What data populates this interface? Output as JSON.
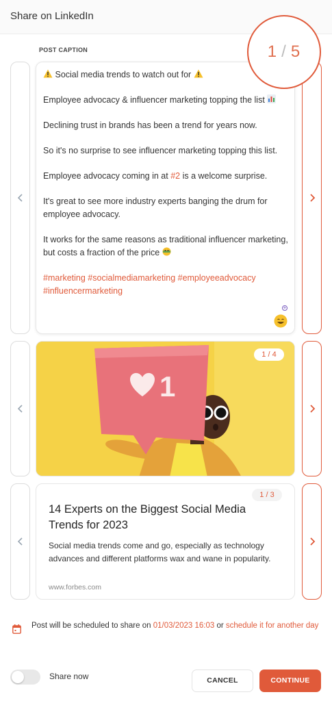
{
  "header": {
    "title": "Share on LinkedIn"
  },
  "caption_section": {
    "label": "POST CAPTION"
  },
  "post_counter": {
    "current": "1",
    "total": "5"
  },
  "caption": {
    "line1": "Social media trends to watch out for",
    "line2": "Employee advocacy & influencer marketing topping the list",
    "para2": "Declining trust in brands has been a trend for years now.",
    "para3": "So it's no surprise to see influencer marketing topping this list.",
    "para4_before": "Employee advocacy coming in at ",
    "para4_tag": "#2",
    "para4_after": " is a welcome surprise.",
    "para5": "It's great to see more industry experts banging the drum for employee advocacy.",
    "para6": "It works for the same reasons as traditional influencer marketing, but costs a fraction of the price",
    "hashtags": "#marketing #socialmediamarketing #employeeadvocacy #influencermarketing"
  },
  "image": {
    "counter": "1 / 4",
    "sign_number": "1"
  },
  "link_preview": {
    "counter": "1 / 3",
    "title": "14 Experts on the Biggest Social Media Trends for 2023",
    "description": "Social media trends come and go, especially as technology advances and different platforms wax and wane in popularity.",
    "domain": "www.forbes.com"
  },
  "schedule": {
    "prefix": "Post will be scheduled to share on ",
    "datetime": "01/03/2023 16:03",
    "middle": " or ",
    "link": "schedule it for another day"
  },
  "share_now": {
    "label": "Share now",
    "enabled": false
  },
  "buttons": {
    "cancel": "CANCEL",
    "continue": "CONTINUE"
  },
  "colors": {
    "accent": "#e05a3a",
    "image_bg": "#f5d247"
  },
  "icons": [
    "chevron-left-icon",
    "chevron-right-icon",
    "warning-icon",
    "bar-chart-icon",
    "emoji-icon",
    "calendar-icon"
  ]
}
